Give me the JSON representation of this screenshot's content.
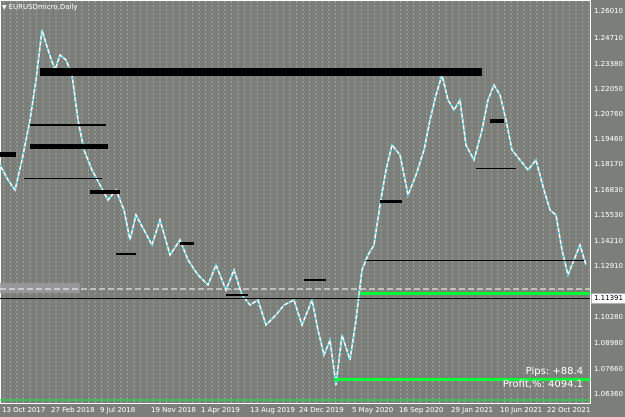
{
  "window": {
    "symbol_title": "EURUSDmicro,Daily"
  },
  "price_axis": {
    "labels": [
      "1.26010",
      "1.24710",
      "1.23380",
      "1.22050",
      "1.20760",
      "1.19460",
      "1.18170",
      "1.16830",
      "1.15530",
      "1.14210",
      "1.12910",
      "1.10280",
      "1.08980",
      "1.07660",
      "1.06360"
    ],
    "current_price": "1.11391"
  },
  "time_axis": {
    "labels": [
      "13 Oct 2017",
      "27 Feb 2018",
      "9 Jul 2018",
      "19 Nov 2018",
      "1 Apr 2019",
      "13 Aug 2019",
      "24 Dec 2019",
      "5 May 2020",
      "16 Sep 2020",
      "29 Jan 2021",
      "10 Jun 2021",
      "22 Oct 2021"
    ]
  },
  "overlay": {
    "pips_text": "Pips: +88.4",
    "profit_text": "Profit,%: 4094.1"
  },
  "colors": {
    "background": "#7c7f79",
    "grid": "#ffffff",
    "bull": "#00e5ff",
    "bear": "#ffffff",
    "level_line": "#000000",
    "profit_line": "#00ff33"
  }
}
